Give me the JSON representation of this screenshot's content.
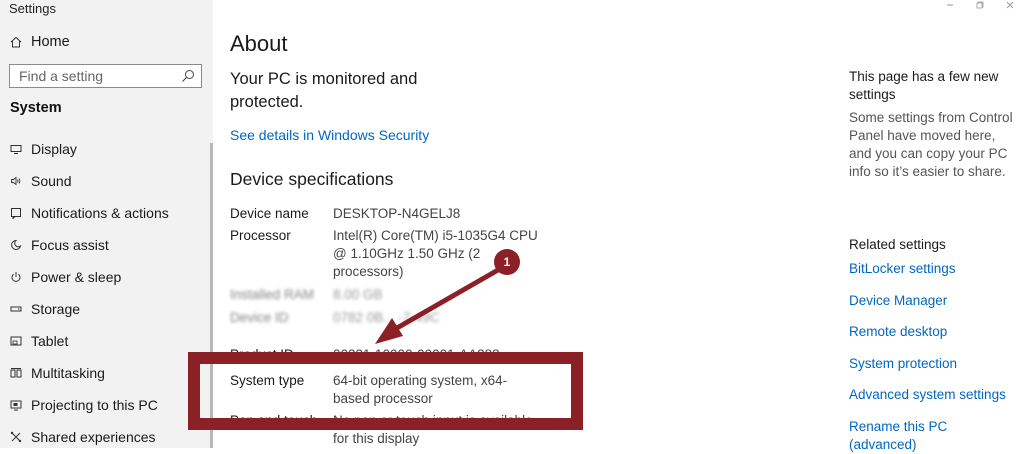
{
  "window": {
    "title": "Settings",
    "controls": [
      "minimize-icon",
      "maximize-icon",
      "close-icon"
    ]
  },
  "sidebar": {
    "home_label": "Home",
    "search_placeholder": "Find a setting",
    "section": "System",
    "items": [
      {
        "label": "Display",
        "icon": "display-icon"
      },
      {
        "label": "Sound",
        "icon": "sound-icon"
      },
      {
        "label": "Notifications & actions",
        "icon": "notifications-icon"
      },
      {
        "label": "Focus assist",
        "icon": "focus-assist-icon"
      },
      {
        "label": "Power & sleep",
        "icon": "power-icon"
      },
      {
        "label": "Storage",
        "icon": "storage-icon"
      },
      {
        "label": "Tablet",
        "icon": "tablet-icon"
      },
      {
        "label": "Multitasking",
        "icon": "multitasking-icon"
      },
      {
        "label": "Projecting to this PC",
        "icon": "projecting-icon"
      },
      {
        "label": "Shared experiences",
        "icon": "shared-experiences-icon"
      }
    ]
  },
  "main": {
    "title": "About",
    "protection_text": "Your PC is monitored and protected.",
    "security_link": "See details in Windows Security",
    "specs_title": "Device specifications",
    "specs": [
      {
        "label": "Device name",
        "value": "DESKTOP-N4GELJ8"
      },
      {
        "label": "Processor",
        "value": "Intel(R) Core(TM) i5-1035G4 CPU @ 1.10GHz   1.50 GHz  (2 processors)"
      },
      {
        "label": "Installed RAM",
        "value": "8.00 GB"
      },
      {
        "label": "Device ID",
        "value": "0782 0B... -7-49C"
      },
      {
        "label": "Product ID",
        "value": "00331-10000-00001-AA288"
      },
      {
        "label": "System type",
        "value": "64-bit operating system, x64-based processor"
      },
      {
        "label": "Pen and touch",
        "value": "No pen or touch input is available for this display"
      }
    ]
  },
  "right": {
    "notice_title": "This page has a few new settings",
    "notice_text": "Some settings from Control Panel have moved here, and you can copy your PC info so it’s easier to share.",
    "related_title": "Related settings",
    "links": [
      "BitLocker settings",
      "Device Manager",
      "Remote desktop",
      "System protection",
      "Advanced system settings",
      "Rename this PC (advanced)"
    ]
  },
  "annotation": {
    "badge": "1",
    "color": "#8b2026"
  },
  "colors": {
    "accent": "#0067c0",
    "sidebar_bg": "#f2f2f2"
  }
}
